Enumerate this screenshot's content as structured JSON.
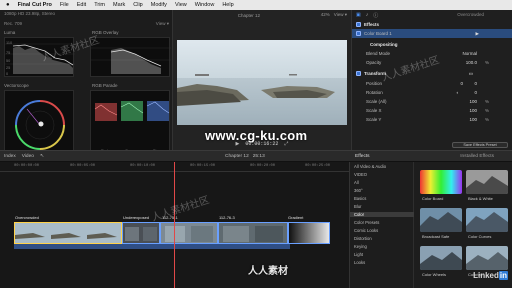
{
  "menubar": {
    "apple": "",
    "app": "Final Cut Pro",
    "items": [
      "File",
      "Edit",
      "Trim",
      "Mark",
      "Clip",
      "Modify",
      "View",
      "Window",
      "Help"
    ],
    "watermark": "人人素材社区"
  },
  "scopes": {
    "format": "1080p HD 23.98p, Stereo",
    "rec": "Rec. 709",
    "view_label": "View",
    "luma_label": "Luma",
    "rgb_overlay_label": "RGB Overlay",
    "vectorscope_label": "Vectorscope",
    "rgb_parade_label": "RGB Parade",
    "luma_ticks": [
      "110",
      "75",
      "50",
      "25",
      "0"
    ],
    "parade_channels": [
      "Red",
      "Green",
      "Blue"
    ]
  },
  "viewer": {
    "title": "Chapter 12",
    "zoom": "42%",
    "view_label": "View",
    "timecode": "00:00:16:22",
    "overlay_watermark": "www.cg-ku.com"
  },
  "inspector": {
    "title": "Overcrowded",
    "effects_label": "Effects",
    "color_board": "Color Board 1",
    "compositing": "Compositing",
    "blend_mode_label": "Blend Mode",
    "blend_mode_value": "Normal",
    "opacity_label": "Opacity",
    "opacity_value": "100.0",
    "opacity_unit": "%",
    "transform": "Transform",
    "position_label": "Position",
    "position_x": "0",
    "position_y": "0",
    "rotation_label": "Rotation",
    "rotation_value": "0",
    "scale_all_label": "Scale (All)",
    "scale_all_value": "100",
    "scale_x_label": "Scale X",
    "scale_x_value": "100",
    "scale_y_label": "Scale Y",
    "scale_y_value": "100",
    "pct": "%",
    "save_preset": "Save Effects Preset"
  },
  "timeline_toolbar": {
    "index_label": "Index",
    "video_label": "Video",
    "project": "Chapter 12",
    "duration": "25:13",
    "effects_tab": "Effects",
    "installed_effects": "Installed Effects"
  },
  "timeline": {
    "ruler": [
      "00:00:00:00",
      "00:00:05:00",
      "00:00:10:00",
      "00:00:15:00",
      "00:00:20:00",
      "00:00:25:00"
    ],
    "clips": [
      "Overcrowded",
      "Underexposed",
      "112-75-1",
      "112-76-3",
      "Gradient"
    ]
  },
  "effects_browser": {
    "categories": [
      "All Video & Audio",
      "VIDEO",
      "All",
      "360°",
      "Basics",
      "Blur",
      "Color",
      "Color Presets",
      "Comic Looks",
      "Distortion",
      "Keying",
      "Light",
      "Looks"
    ],
    "selected_category": "Color",
    "thumbs": [
      "Color Board",
      "Black & White",
      "Broadcast Safe",
      "Color Curves",
      "Color Wheels",
      "Colorize"
    ],
    "brand": "Linked"
  },
  "watermarks": {
    "site": "人人素材社区",
    "bottom": "人人素材"
  }
}
